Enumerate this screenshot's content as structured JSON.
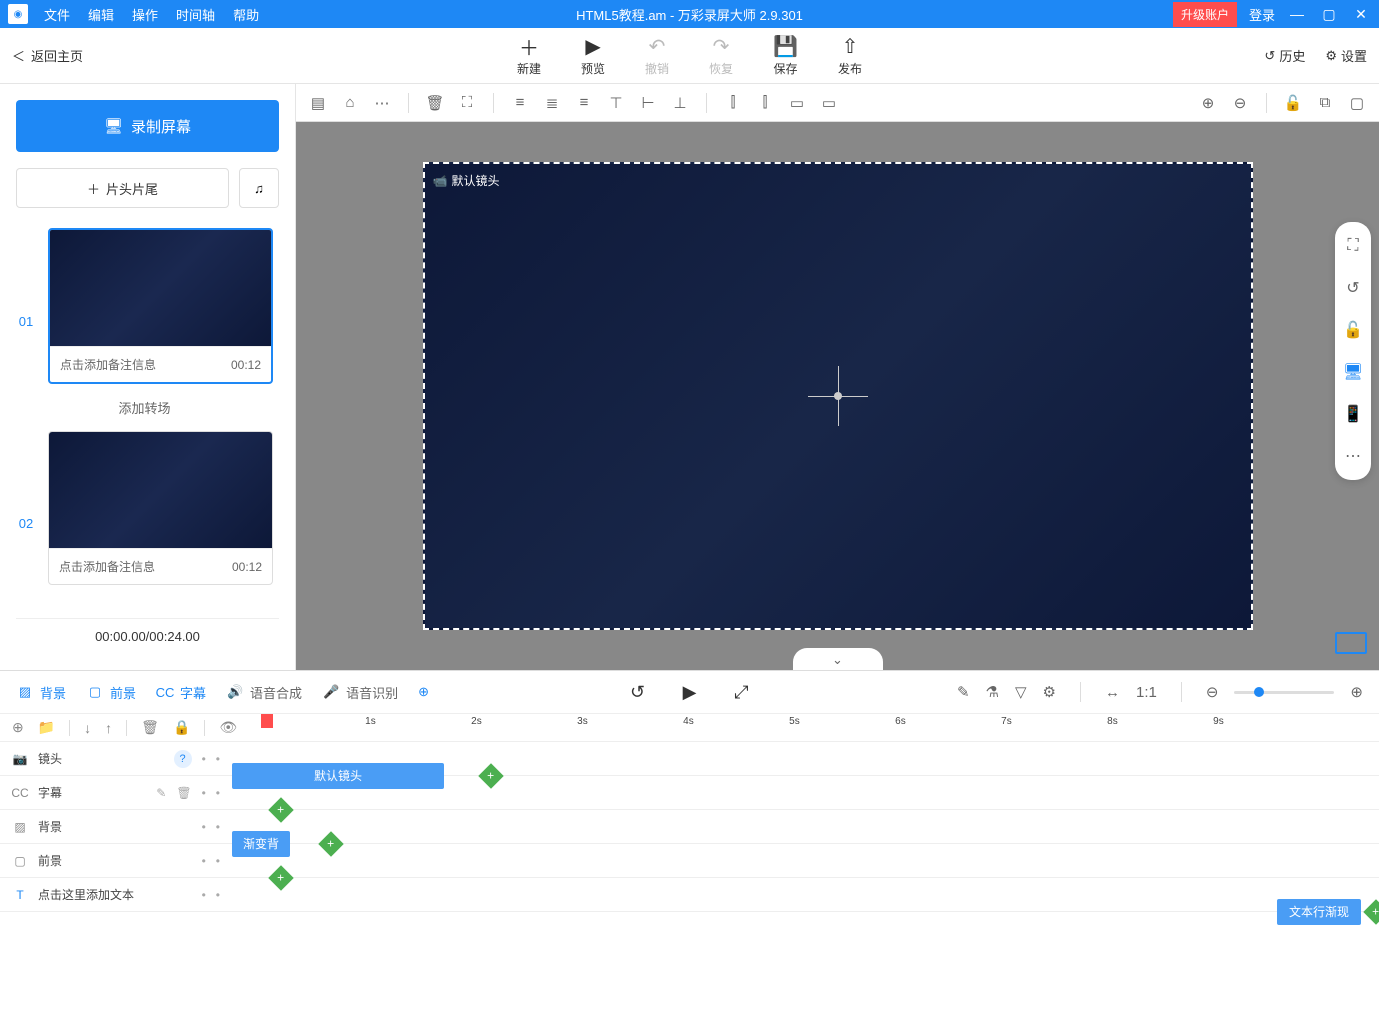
{
  "titlebar": {
    "menus": [
      "文件",
      "编辑",
      "操作",
      "时间轴",
      "帮助"
    ],
    "title": "HTML5教程.am - 万彩录屏大师 2.9.301",
    "upgrade": "升级账户",
    "login": "登录"
  },
  "toolbar": {
    "back": "返回主页",
    "actions": [
      {
        "icon": "＋",
        "label": "新建",
        "disabled": false
      },
      {
        "icon": "▶",
        "label": "预览",
        "disabled": false
      },
      {
        "icon": "↶",
        "label": "撤销",
        "disabled": true
      },
      {
        "icon": "↷",
        "label": "恢复",
        "disabled": true
      },
      {
        "icon": "💾",
        "label": "保存",
        "disabled": false
      },
      {
        "icon": "⇧",
        "label": "发布",
        "disabled": false
      }
    ],
    "history": "历史",
    "settings": "设置"
  },
  "sidebar": {
    "record": "录制屏幕",
    "intro": "片头片尾",
    "scenes": [
      {
        "num": "01",
        "note": "点击添加备注信息",
        "duration": "00:12",
        "active": true
      },
      {
        "num": "02",
        "note": "点击添加备注信息",
        "duration": "00:12",
        "active": false
      }
    ],
    "transition": "添加转场",
    "counter": "00:00.00/00:24.00"
  },
  "canvas": {
    "label": "默认镜头"
  },
  "timeline_tabs": {
    "tabs": [
      {
        "icon": "▨",
        "label": "背景"
      },
      {
        "icon": "▢",
        "label": "前景"
      },
      {
        "icon": "CC",
        "label": "字幕"
      },
      {
        "icon": "🔊",
        "label": "语音合成"
      },
      {
        "icon": "🎤",
        "label": "语音识别"
      }
    ]
  },
  "ruler": {
    "marks": [
      "1s",
      "2s",
      "3s",
      "4s",
      "5s",
      "6s",
      "7s",
      "8s",
      "9s"
    ]
  },
  "tracks": [
    {
      "icon": "📷",
      "label": "镜头",
      "hasQ": true
    },
    {
      "icon": "CC",
      "label": "字幕",
      "hasQ": false
    },
    {
      "icon": "▨",
      "label": "背景",
      "hasQ": false
    },
    {
      "icon": "▢",
      "label": "前景",
      "hasQ": false
    },
    {
      "icon": "T",
      "label": "点击这里添加文本",
      "hasQ": false
    }
  ],
  "clips": {
    "default_shot": "默认镜头",
    "gradient_bg": "渐变背",
    "text_effect": "文本行渐现"
  }
}
